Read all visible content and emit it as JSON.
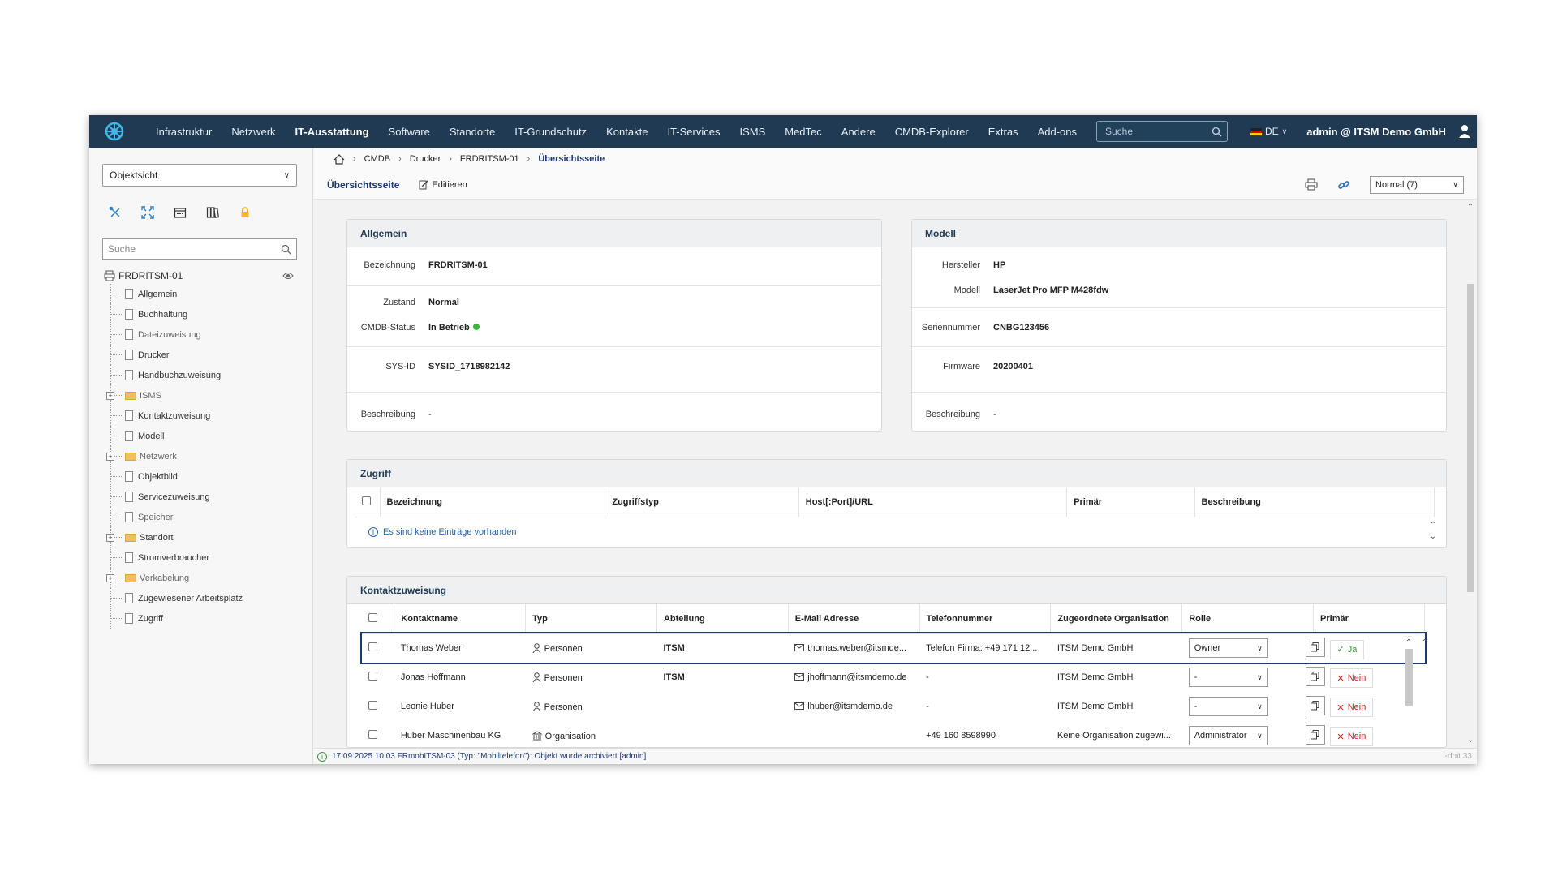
{
  "nav": {
    "items": [
      "Infrastruktur",
      "Netzwerk",
      "IT-Ausstattung",
      "Software",
      "Standorte",
      "IT-Grundschutz",
      "Kontakte",
      "IT-Services",
      "ISMS",
      "MedTec",
      "Andere",
      "CMDB-Explorer",
      "Extras",
      "Add-ons"
    ],
    "search_placeholder": "Suche",
    "lang": "DE",
    "user": "admin @ ITSM Demo GmbH"
  },
  "sidebar": {
    "view_select": "Objektsicht",
    "search_placeholder": "Suche",
    "root": "FRDRITSM-01",
    "items": [
      {
        "label": "Allgemein",
        "type": "doc"
      },
      {
        "label": "Buchhaltung",
        "type": "doc"
      },
      {
        "label": "Dateizuweisung",
        "type": "doc"
      },
      {
        "label": "Drucker",
        "type": "doc"
      },
      {
        "label": "Handbuchzuweisung",
        "type": "doc"
      },
      {
        "label": "ISMS",
        "type": "folder"
      },
      {
        "label": "Kontaktzuweisung",
        "type": "doc"
      },
      {
        "label": "Modell",
        "type": "doc"
      },
      {
        "label": "Netzwerk",
        "type": "folder"
      },
      {
        "label": "Objektbild",
        "type": "doc"
      },
      {
        "label": "Servicezuweisung",
        "type": "doc"
      },
      {
        "label": "Speicher",
        "type": "doc"
      },
      {
        "label": "Standort",
        "type": "folder"
      },
      {
        "label": "Stromverbraucher",
        "type": "doc"
      },
      {
        "label": "Verkabelung",
        "type": "folder"
      },
      {
        "label": "Zugewiesener Arbeitsplatz",
        "type": "doc"
      },
      {
        "label": "Zugriff",
        "type": "doc"
      }
    ]
  },
  "breadcrumb": [
    "CMDB",
    "Drucker",
    "FRDRITSM-01",
    "Übersichtsseite"
  ],
  "toolbar": {
    "tab": "Übersichtsseite",
    "edit": "Editieren",
    "view": "Normal (7)"
  },
  "allgemein": {
    "title": "Allgemein",
    "bezeichnung_k": "Bezeichnung",
    "bezeichnung_v": "FRDRITSM-01",
    "zustand_k": "Zustand",
    "zustand_v": "Normal",
    "status_k": "CMDB-Status",
    "status_v": "In Betrieb",
    "sysid_k": "SYS-ID",
    "sysid_v": "SYSID_1718982142",
    "beschreibung_k": "Beschreibung",
    "beschreibung_v": "-"
  },
  "modell": {
    "title": "Modell",
    "hersteller_k": "Hersteller",
    "hersteller_v": "HP",
    "modell_k": "Modell",
    "modell_v": "LaserJet Pro MFP M428fdw",
    "serien_k": "Seriennummer",
    "serien_v": "CNBG123456",
    "firmware_k": "Firmware",
    "firmware_v": "20200401",
    "beschreibung_k": "Beschreibung",
    "beschreibung_v": "-"
  },
  "zugriff": {
    "title": "Zugriff",
    "columns": [
      "Bezeichnung",
      "Zugriffstyp",
      "Host[:Port]/URL",
      "Primär",
      "Beschreibung"
    ],
    "empty": "Es sind keine Einträge vorhanden"
  },
  "kontakte": {
    "title": "Kontaktzuweisung",
    "columns": [
      "Kontaktname",
      "Typ",
      "Abteilung",
      "E-Mail Adresse",
      "Telefonnummer",
      "Zugeordnete Organisation",
      "Rolle",
      "Primär"
    ],
    "rows": [
      {
        "name": "Thomas Weber",
        "typ": "Personen",
        "abteilung": "ITSM",
        "email": "thomas.weber@itsmde...",
        "telefon": "Telefon Firma: +49 171 12...",
        "org": "ITSM Demo GmbH",
        "rolle": "Owner",
        "primaer": "Ja",
        "primaer_yes": true
      },
      {
        "name": "Jonas Hoffmann",
        "typ": "Personen",
        "abteilung": "ITSM",
        "email": "jhoffmann@itsmdemo.de",
        "telefon": "-",
        "org": "ITSM Demo GmbH",
        "rolle": "-",
        "primaer": "Nein",
        "primaer_yes": false
      },
      {
        "name": "Leonie Huber",
        "typ": "Personen",
        "abteilung": "",
        "email": "lhuber@itsmdemo.de",
        "telefon": "-",
        "org": "ITSM Demo GmbH",
        "rolle": "-",
        "primaer": "Nein",
        "primaer_yes": false
      },
      {
        "name": "Huber Maschinenbau KG",
        "typ": "Organisation",
        "abteilung": "",
        "email": "",
        "telefon": "+49 160 8598990",
        "org": "Keine Organisation zugewi...",
        "rolle": "Administrator",
        "primaer": "Nein",
        "primaer_yes": false
      }
    ]
  },
  "statusbar": {
    "message": "17.09.2025 10:03 FRmobITSM-03 (Typ: \"Mobiltelefon\"): Objekt wurde archiviert [admin]",
    "version": "i-doit 33"
  },
  "colors": {
    "nav_bg": "#1f3a52",
    "accent": "#1f3a70",
    "ok": "#3cb33c",
    "no": "#cc2222"
  }
}
